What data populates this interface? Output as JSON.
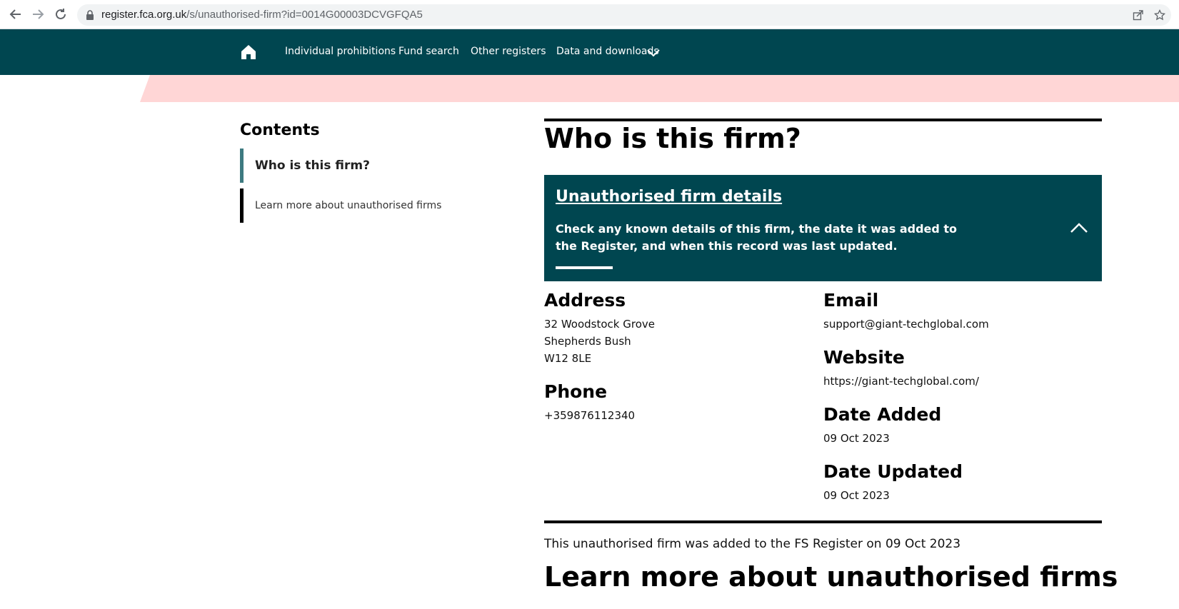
{
  "browser": {
    "url_host": "register.fca.org.uk",
    "url_path": "/s/unauthorised-firm?id=0014G00003DCVGFQA5"
  },
  "nav": {
    "items": [
      "Individual prohibitions",
      "Fund search",
      "Other registers",
      "Data and downloads"
    ]
  },
  "colors": {
    "header_bg": "#004650",
    "pink_band": "#ffd6d6",
    "toc_active": "#3d7a80"
  },
  "sidebar": {
    "title": "Contents",
    "items": [
      "Who is this firm?",
      "Learn more about unauthorised firms"
    ]
  },
  "main": {
    "title": "Who is this firm?",
    "panel": {
      "heading": "Unauthorised firm details",
      "description": "Check any known details of this firm, the date it was added to the Register, and when this record was last updated."
    },
    "address": {
      "label": "Address",
      "lines": [
        "32 Woodstock Grove",
        "Shepherds Bush",
        "W12 8LE"
      ]
    },
    "phone": {
      "label": "Phone",
      "value": "+359876112340"
    },
    "email": {
      "label": "Email",
      "value": "support@giant-techglobal.com"
    },
    "website": {
      "label": "Website",
      "value": "https://giant-techglobal.com/"
    },
    "date_added": {
      "label": "Date Added",
      "value": "09 Oct 2023"
    },
    "date_updated": {
      "label": "Date Updated",
      "value": "09 Oct 2023"
    },
    "footer_note": "This unauthorised firm was added to the FS Register on 09 Oct 2023",
    "learn_title": "Learn more about unauthorised firms"
  }
}
